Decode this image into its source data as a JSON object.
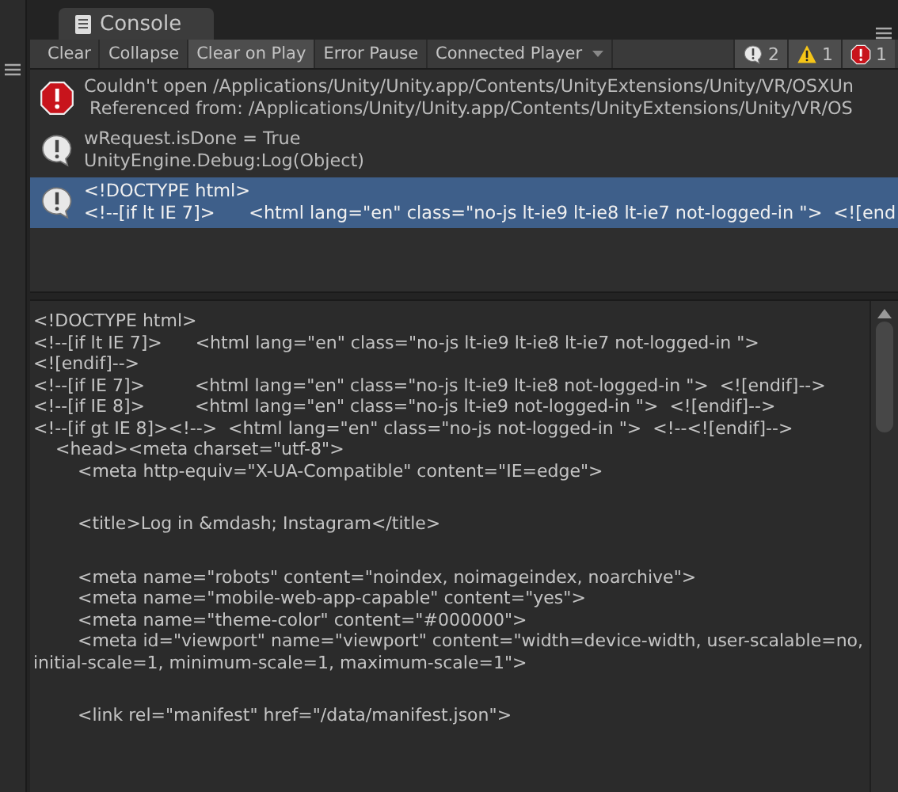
{
  "tab": {
    "title": "Console"
  },
  "toolbar": {
    "buttons": [
      {
        "label": "Clear",
        "selected": false
      },
      {
        "label": "Collapse",
        "selected": false
      },
      {
        "label": "Clear on Play",
        "selected": true
      },
      {
        "label": "Error Pause",
        "selected": false
      }
    ],
    "player": {
      "label": "Connected Player"
    },
    "counters": [
      {
        "kind": "log",
        "count": "2",
        "selected": true
      },
      {
        "kind": "warning",
        "count": "1",
        "selected": true
      },
      {
        "kind": "error",
        "count": "1",
        "selected": true
      }
    ]
  },
  "entries": [
    {
      "kind": "error",
      "selected": false,
      "line1": "Couldn't open /Applications/Unity/Unity.app/Contents/UnityExtensions/Unity/VR/OSXUn",
      "line2": " Referenced from: /Applications/Unity/Unity.app/Contents/UnityExtensions/Unity/VR/OS"
    },
    {
      "kind": "log",
      "selected": false,
      "line1": "wRequest.isDone = True",
      "line2": "UnityEngine.Debug:Log(Object)"
    },
    {
      "kind": "log",
      "selected": true,
      "line1": "<!DOCTYPE html>",
      "line2": "<!--[if lt IE 7]>      <html lang=\"en\" class=\"no-js lt-ie9 lt-ie8 lt-ie7 not-logged-in \">  <![end"
    }
  ],
  "detail": {
    "blocks": [
      {
        "lines": [
          "<!DOCTYPE html>",
          "<!--[if lt IE 7]>      <html lang=\"en\" class=\"no-js lt-ie9 lt-ie8 lt-ie7 not-logged-in \">",
          "<![endif]-->",
          "<!--[if IE 7]>         <html lang=\"en\" class=\"no-js lt-ie9 lt-ie8 not-logged-in \">  <![endif]-->",
          "<!--[if IE 8]>         <html lang=\"en\" class=\"no-js lt-ie9 not-logged-in \">  <![endif]-->",
          "<!--[if gt IE 8]><!-->  <html lang=\"en\" class=\"no-js not-logged-in \">  <!--<![endif]-->",
          "    <head><meta charset=\"utf-8\">",
          "        <meta http-equiv=\"X-UA-Compatible\" content=\"IE=edge\">"
        ]
      },
      {
        "lines": [
          "        <title>Log in &mdash; Instagram</title>"
        ]
      },
      {
        "lines": [
          "        <meta name=\"robots\" content=\"noindex, noimageindex, noarchive\">",
          "        <meta name=\"mobile-web-app-capable\" content=\"yes\">",
          "        <meta name=\"theme-color\" content=\"#000000\">",
          "        <meta id=\"viewport\" name=\"viewport\" content=\"width=device-width, user-scalable=no,",
          "initial-scale=1, minimum-scale=1, maximum-scale=1\">"
        ]
      },
      {
        "lines": [
          "        <link rel=\"manifest\" href=\"/data/manifest.json\">"
        ]
      }
    ]
  }
}
